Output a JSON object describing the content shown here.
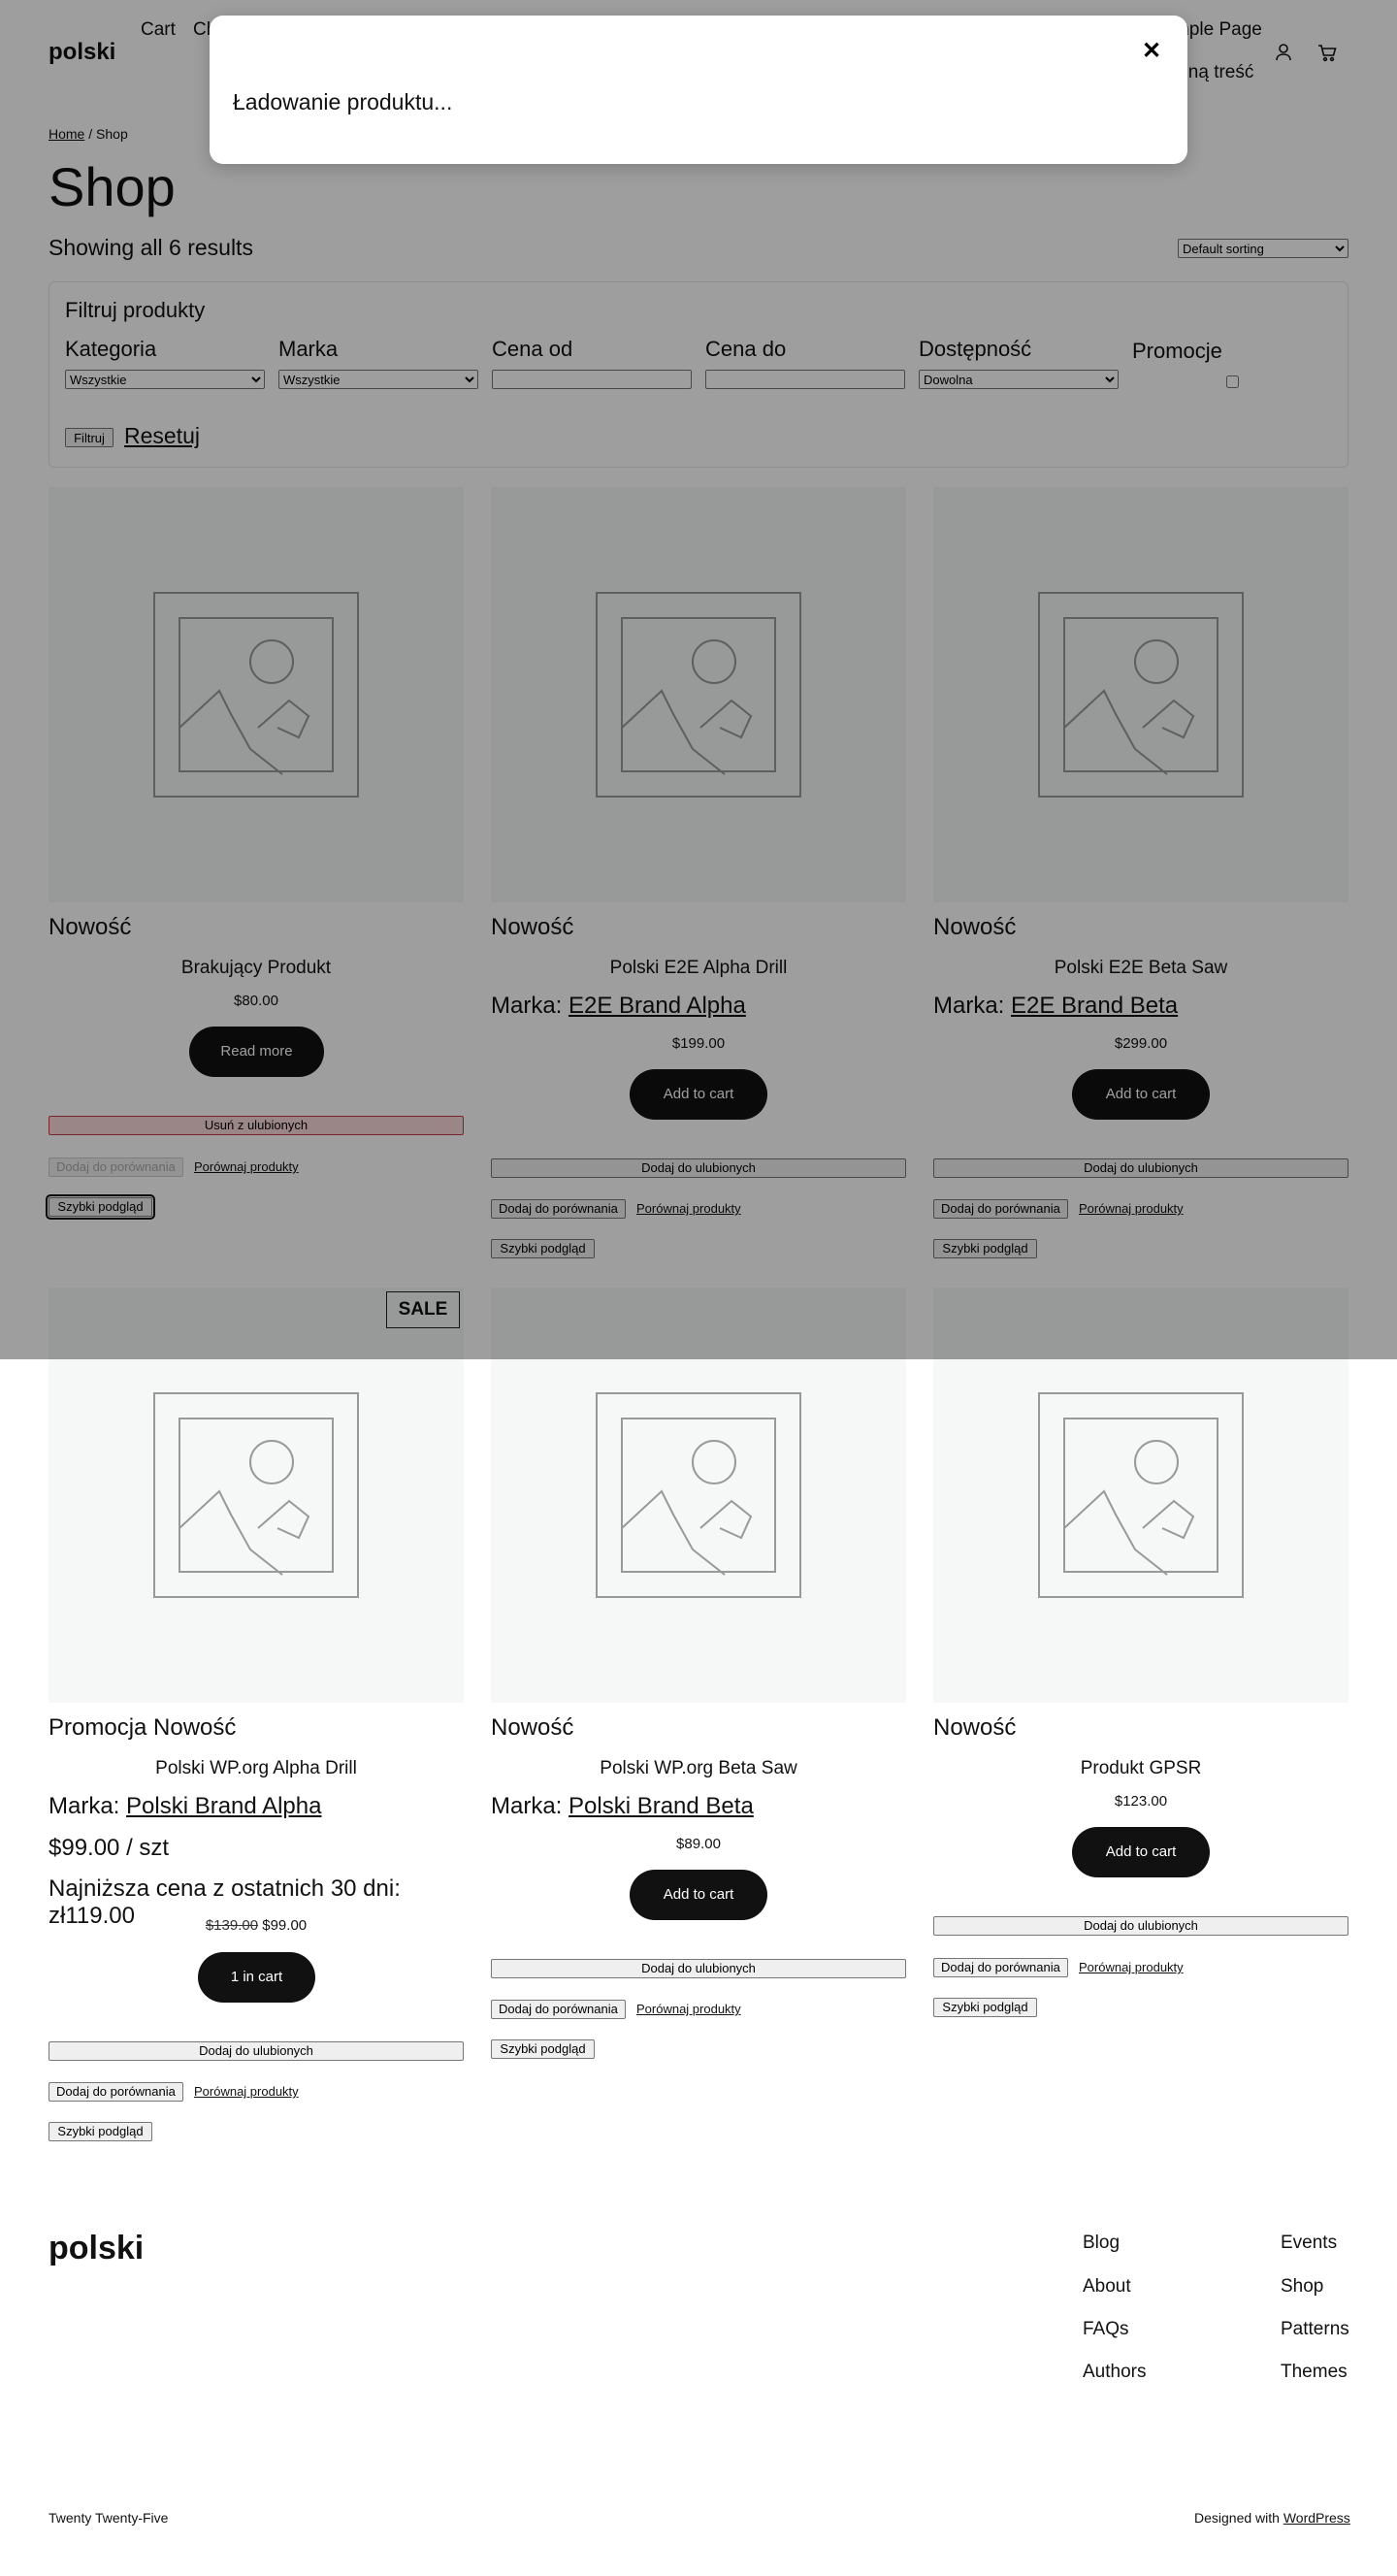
{
  "header": {
    "site_title": "polski",
    "nav": [
      "Cart",
      "Ch",
      "mple Page",
      "alną treść"
    ]
  },
  "breadcrumb": {
    "home": "Home",
    "separator": " / ",
    "current": "Shop"
  },
  "page_title": "Shop",
  "result_count": "Showing all 6 results",
  "sorting": {
    "selected": "Default sorting"
  },
  "filter": {
    "title": "Filtruj produkty",
    "category_label": "Kategoria",
    "category_value": "Wszystkie",
    "brand_label": "Marka",
    "brand_value": "Wszystkie",
    "price_from_label": "Cena od",
    "price_to_label": "Cena do",
    "availability_label": "Dostępność",
    "availability_value": "Dowolna",
    "promo_label": "Promocje",
    "submit": "Filtruj",
    "reset": "Resetuj"
  },
  "products": [
    {
      "tags": "Nowość",
      "name": "Brakujący Produkt",
      "price": "$80.00",
      "cart_label": "Read more",
      "favorite_label": "Usuń z ulubionych",
      "compare_label": "Dodaj do porównania",
      "compare_link": "Porównaj produkty",
      "quick_view": "Szybki podgląd"
    },
    {
      "tags": "Nowość",
      "name": "Polski E2E Alpha Drill",
      "brand_prefix": "Marka: ",
      "brand": "E2E Brand Alpha",
      "price": "$199.00",
      "cart_label": "Add to cart",
      "favorite_label": "Dodaj do ulubionych",
      "compare_label": "Dodaj do porównania",
      "compare_link": "Porównaj produkty",
      "quick_view": "Szybki podgląd"
    },
    {
      "tags": "Nowość",
      "name": "Polski E2E Beta Saw",
      "brand_prefix": "Marka: ",
      "brand": "E2E Brand Beta",
      "price": "$299.00",
      "cart_label": "Add to cart",
      "favorite_label": "Dodaj do ulubionych",
      "compare_label": "Dodaj do porównania",
      "compare_link": "Porównaj produkty",
      "quick_view": "Szybki podgląd"
    },
    {
      "badge": "SALE",
      "tags": "Promocja Nowość",
      "name": "Polski WP.org Alpha Drill",
      "brand_prefix": "Marka: ",
      "brand": "Polski Brand Alpha",
      "unit_price": "$99.00 / szt",
      "lowest_price": "Najniższa cena z ostatnich 30 dni: zł119.00",
      "price_old": "$139.00",
      "price": "$99.00",
      "cart_label": "1 in cart",
      "favorite_label": "Dodaj do ulubionych",
      "compare_label": "Dodaj do porównania",
      "compare_link": "Porównaj produkty",
      "quick_view": "Szybki podgląd"
    },
    {
      "tags": "Nowość",
      "name": "Polski WP.org Beta Saw",
      "brand_prefix": "Marka: ",
      "brand": "Polski Brand Beta",
      "price": "$89.00",
      "cart_label": "Add to cart",
      "favorite_label": "Dodaj do ulubionych",
      "compare_label": "Dodaj do porównania",
      "compare_link": "Porównaj produkty",
      "quick_view": "Szybki podgląd"
    },
    {
      "tags": "Nowość",
      "name": "Produkt GPSR",
      "price": "$123.00",
      "cart_label": "Add to cart",
      "favorite_label": "Dodaj do ulubionych",
      "compare_label": "Dodaj do porównania",
      "compare_link": "Porównaj produkty",
      "quick_view": "Szybki podgląd"
    }
  ],
  "footer": {
    "title": "polski",
    "links_col1": [
      "Blog",
      "About",
      "FAQs",
      "Authors"
    ],
    "links_col2": [
      "Events",
      "Shop",
      "Patterns",
      "Themes"
    ],
    "credit": "Twenty Twenty-Five",
    "designed_prefix": "Designed with ",
    "designed_link": "WordPress"
  },
  "modal": {
    "close": "✕",
    "message": "Ładowanie produktu..."
  },
  "icons": [
    "account-icon",
    "cart-icon",
    "close-icon",
    "placeholder-image-icon"
  ]
}
